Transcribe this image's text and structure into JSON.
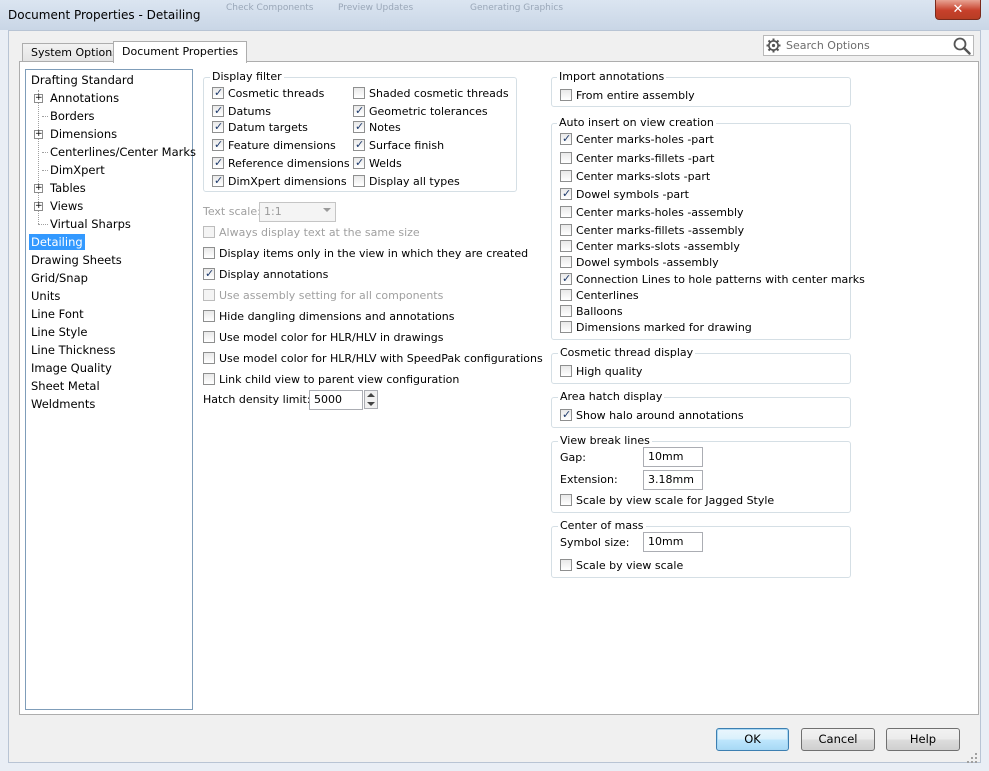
{
  "window": {
    "title": "Document Properties - Detailing",
    "background_ghost_labels": [
      "Check Components",
      "Preview Updates",
      "Generating Graphics"
    ],
    "close_symbol": "✕"
  },
  "tabs": [
    {
      "label": "System Options",
      "active": false
    },
    {
      "label": "Document Properties",
      "active": true
    }
  ],
  "search": {
    "placeholder": "Search Options",
    "icon": "gear-icon"
  },
  "tree": [
    {
      "label": "Drafting Standard",
      "level": 0,
      "expandable": false
    },
    {
      "label": "Annotations",
      "level": 1,
      "expandable": true
    },
    {
      "label": "Borders",
      "level": 1,
      "expandable": false
    },
    {
      "label": "Dimensions",
      "level": 1,
      "expandable": true
    },
    {
      "label": "Centerlines/Center Marks",
      "level": 1,
      "expandable": false
    },
    {
      "label": "DimXpert",
      "level": 1,
      "expandable": false
    },
    {
      "label": "Tables",
      "level": 1,
      "expandable": true
    },
    {
      "label": "Views",
      "level": 1,
      "expandable": true
    },
    {
      "label": "Virtual Sharps",
      "level": 1,
      "expandable": false
    },
    {
      "label": "Detailing",
      "level": 0,
      "selected": true
    },
    {
      "label": "Drawing Sheets",
      "level": 0
    },
    {
      "label": "Grid/Snap",
      "level": 0
    },
    {
      "label": "Units",
      "level": 0
    },
    {
      "label": "Line Font",
      "level": 0
    },
    {
      "label": "Line Style",
      "level": 0
    },
    {
      "label": "Line Thickness",
      "level": 0
    },
    {
      "label": "Image Quality",
      "level": 0
    },
    {
      "label": "Sheet Metal",
      "level": 0
    },
    {
      "label": "Weldments",
      "level": 0
    }
  ],
  "display_filter": {
    "title": "Display filter",
    "left": [
      {
        "label": "Cosmetic threads",
        "checked": true
      },
      {
        "label": "Datums",
        "checked": true
      },
      {
        "label": "Datum targets",
        "checked": true
      },
      {
        "label": "Feature dimensions",
        "checked": true
      },
      {
        "label": "Reference dimensions",
        "checked": true
      },
      {
        "label": "DimXpert dimensions",
        "checked": true
      }
    ],
    "right": [
      {
        "label": "Shaded cosmetic threads",
        "checked": false
      },
      {
        "label": "Geometric tolerances",
        "checked": true
      },
      {
        "label": "Notes",
        "checked": true
      },
      {
        "label": "Surface finish",
        "checked": true
      },
      {
        "label": "Welds",
        "checked": true
      },
      {
        "label": "Display all types",
        "checked": false
      }
    ]
  },
  "text_scale": {
    "label": "Text scale:",
    "value": "1:1"
  },
  "options": [
    {
      "label": "Always display text at the same size",
      "checked": false,
      "disabled": true
    },
    {
      "label": "Display items only in the view in which they are created",
      "checked": false,
      "disabled": false
    },
    {
      "label": "Display annotations",
      "checked": true,
      "disabled": false
    },
    {
      "label": "Use assembly setting for all components",
      "checked": false,
      "disabled": true
    },
    {
      "label": "Hide dangling dimensions and annotations",
      "checked": false,
      "disabled": false
    },
    {
      "label": "Use model color for HLR/HLV in drawings",
      "checked": false,
      "disabled": false
    },
    {
      "label": "Use model color for HLR/HLV with SpeedPak configurations",
      "checked": false,
      "disabled": false
    },
    {
      "label": "Link child view to parent view configuration",
      "checked": false,
      "disabled": false
    }
  ],
  "hatch_density": {
    "label": "Hatch density limit:",
    "value": "5000"
  },
  "import_annotations": {
    "title": "Import annotations",
    "items": [
      {
        "label": "From entire assembly",
        "checked": false
      }
    ]
  },
  "auto_insert": {
    "title": "Auto insert on view creation",
    "items": [
      {
        "label": "Center marks-holes -part",
        "checked": true
      },
      {
        "label": "Center marks-fillets -part",
        "checked": false
      },
      {
        "label": "Center marks-slots  -part",
        "checked": false
      },
      {
        "label": "Dowel symbols -part",
        "checked": true
      },
      {
        "label": "Center marks-holes -assembly",
        "checked": false
      },
      {
        "label": "Center marks-fillets -assembly",
        "checked": false
      },
      {
        "label": "Center marks-slots  -assembly",
        "checked": false
      },
      {
        "label": "Dowel symbols -assembly",
        "checked": false
      },
      {
        "label": "Connection Lines to hole patterns with center marks",
        "checked": true
      },
      {
        "label": "Centerlines",
        "checked": false
      },
      {
        "label": "Balloons",
        "checked": false
      },
      {
        "label": "Dimensions marked for drawing",
        "checked": false
      }
    ]
  },
  "cosmetic_thread": {
    "title": "Cosmetic thread display",
    "items": [
      {
        "label": "High quality",
        "checked": false
      }
    ]
  },
  "area_hatch": {
    "title": "Area hatch display",
    "items": [
      {
        "label": "Show halo around annotations",
        "checked": true
      }
    ]
  },
  "view_break": {
    "title": "View break lines",
    "gap_label": "Gap:",
    "gap_value": "10mm",
    "extension_label": "Extension:",
    "extension_value": "3.18mm",
    "scale_label": "Scale by view scale for Jagged Style",
    "scale_checked": false
  },
  "center_of_mass": {
    "title": "Center of mass",
    "symbol_label": "Symbol size:",
    "symbol_value": "10mm",
    "scale_label": "Scale by view scale",
    "scale_checked": false
  },
  "buttons": {
    "ok": "OK",
    "cancel": "Cancel",
    "help": "Help"
  },
  "colors": {
    "selection": "#3399ff",
    "default_button_border": "#3c7fb1",
    "close_button": "#c7402b"
  }
}
